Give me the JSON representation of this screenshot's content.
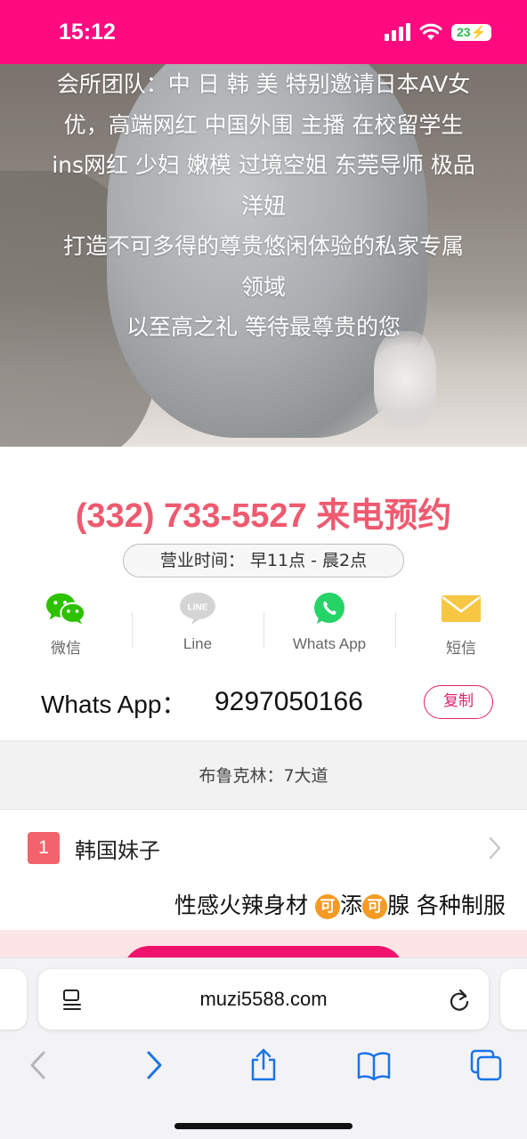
{
  "status_bar": {
    "time": "15:12",
    "battery": "23"
  },
  "hero": {
    "lines": [
      "会所团队：中 日 韩 美 特别邀请日本AV女",
      "优，高端网红 中国外围 主播 在校留学生",
      "ins网红 少妇 嫩模 过境空姐 东莞导师 极品",
      "洋妞",
      "打造不可多得的尊贵悠闲体验的私家专属",
      "领域",
      "以至高之礼 等待最尊贵的您"
    ]
  },
  "phone_cta": "(332) 733-5527 来电预约",
  "hours": "营业时间：  早11点 - 晨2点",
  "contacts": [
    {
      "label": "微信",
      "icon": "wechat-icon",
      "color": "#2dc100"
    },
    {
      "label": "Line",
      "icon": "line-icon",
      "color": "#cfcfcf"
    },
    {
      "label": "Whats App",
      "icon": "whatsapp-icon",
      "color": "#25d366"
    },
    {
      "label": "短信",
      "icon": "mail-icon",
      "color": "#f7c744"
    }
  ],
  "whatsapp": {
    "label": "Whats App：",
    "number": "9297050166",
    "copy_label": "复制"
  },
  "location": "布鲁克林：7大道",
  "list": {
    "rank": "1",
    "title": "韩国妹子",
    "desc_parts": [
      "性感火辣身材 ",
      "可",
      "添",
      "可",
      "腺 各种制服"
    ]
  },
  "browser": {
    "url": "muzi5588.com"
  },
  "colors": {
    "brand": "#ff0a7f",
    "phone": "#ee5a6f",
    "accent": "#e0236e",
    "ios_blue": "#1a73e8"
  }
}
